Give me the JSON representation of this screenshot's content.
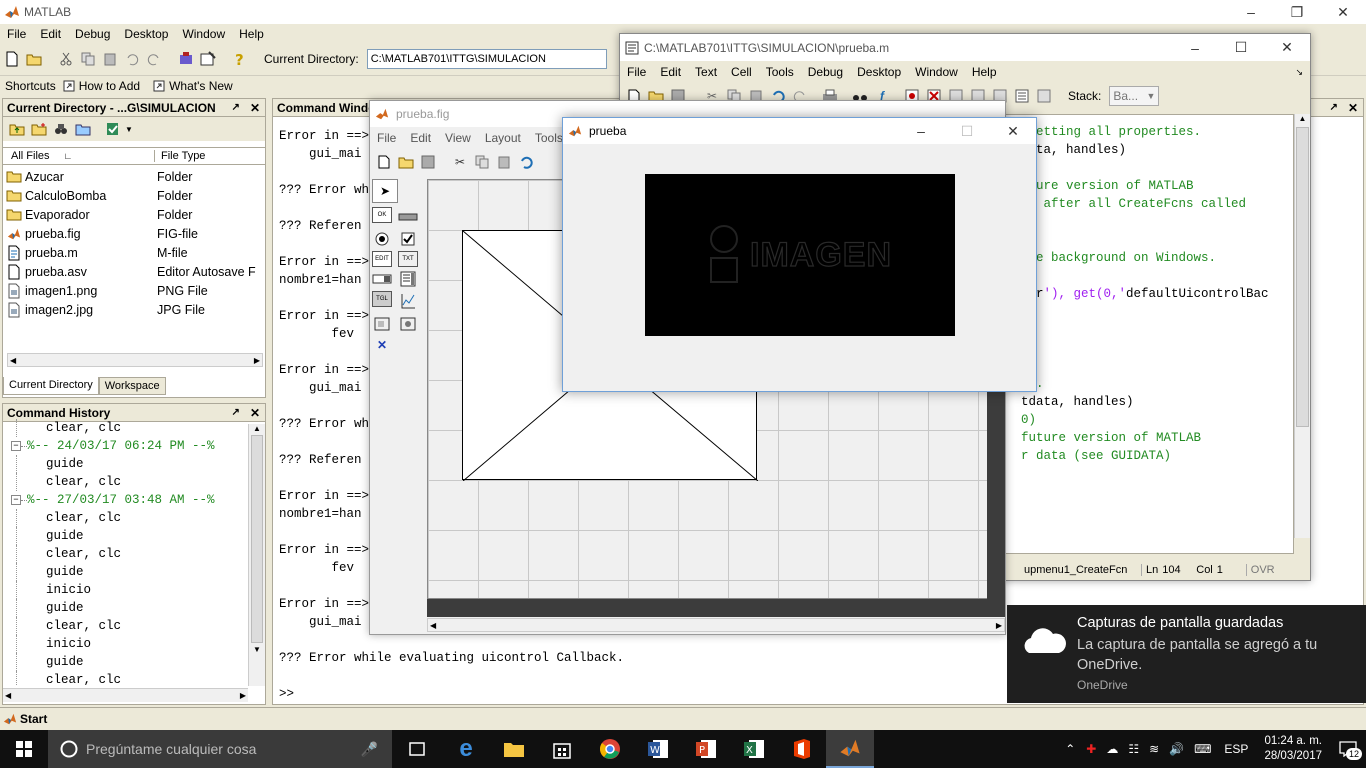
{
  "main_window": {
    "title": "MATLAB",
    "menu": [
      "File",
      "Edit",
      "Debug",
      "Desktop",
      "Window",
      "Help"
    ],
    "current_dir_label": "Current Directory:",
    "current_dir_value": "C:\\MATLAB701\\ITTG\\SIMULACION",
    "shortcuts": {
      "label": "Shortcuts",
      "how_to_add": "How to Add",
      "whats_new": "What's New"
    }
  },
  "current_directory": {
    "title": "Current Directory - ...G\\SIMULACION",
    "columns": [
      "All Files",
      "File Type"
    ],
    "files": [
      {
        "name": "Azucar",
        "type": "Folder",
        "icon": "folder-icon"
      },
      {
        "name": "CalculoBomba",
        "type": "Folder",
        "icon": "folder-icon"
      },
      {
        "name": "Evaporador",
        "type": "Folder",
        "icon": "folder-icon"
      },
      {
        "name": "prueba.fig",
        "type": "FIG-file",
        "icon": "matlab-fig-icon"
      },
      {
        "name": "prueba.m",
        "type": "M-file",
        "icon": "m-file-icon"
      },
      {
        "name": "prueba.asv",
        "type": "Editor Autosave F",
        "icon": "file-icon"
      },
      {
        "name": "imagen1.png",
        "type": "PNG File",
        "icon": "image-file-icon"
      },
      {
        "name": "imagen2.jpg",
        "type": "JPG File",
        "icon": "image-file-icon"
      }
    ],
    "tabs": [
      "Current Directory",
      "Workspace"
    ]
  },
  "command_history": {
    "title": "Command History",
    "items": [
      {
        "text": "clear, clc",
        "kind": "cmd"
      },
      {
        "text": "%-- 24/03/17 06:24 PM --%",
        "kind": "session"
      },
      {
        "text": "guide",
        "kind": "cmd"
      },
      {
        "text": "clear, clc",
        "kind": "cmd"
      },
      {
        "text": "%-- 27/03/17 03:48 AM --%",
        "kind": "session"
      },
      {
        "text": "clear, clc",
        "kind": "cmd"
      },
      {
        "text": "guide",
        "kind": "cmd"
      },
      {
        "text": "clear, clc",
        "kind": "cmd"
      },
      {
        "text": "guide",
        "kind": "cmd"
      },
      {
        "text": "inicio",
        "kind": "cmd"
      },
      {
        "text": "guide",
        "kind": "cmd"
      },
      {
        "text": "clear, clc",
        "kind": "cmd"
      },
      {
        "text": "inicio",
        "kind": "cmd"
      },
      {
        "text": "guide",
        "kind": "cmd"
      },
      {
        "text": "clear, clc",
        "kind": "cmd"
      }
    ]
  },
  "command_window": {
    "title": "Command Windo",
    "lines": [
      "Error in ==>",
      "    gui_mai",
      "",
      "??? Error wh",
      "",
      "??? Referen",
      "",
      "Error in ==>",
      "nombre1=han",
      "",
      "Error in ==>",
      "       fev",
      "",
      "Error in ==>",
      "    gui_mai",
      "",
      "??? Error wh",
      "",
      "??? Referen",
      "",
      "Error in ==>",
      "nombre1=han",
      "",
      "Error in ==>",
      "       fev",
      "",
      "Error in ==>",
      "    gui_mai",
      "",
      "??? Error while evaluating uicontrol Callback.",
      "",
      ">>"
    ]
  },
  "editor": {
    "title": "C:\\MATLAB701\\ITTG\\SIMULACION\\prueba.m",
    "menu": [
      "File",
      "Edit",
      "Text",
      "Cell",
      "Tools",
      "Debug",
      "Desktop",
      "Window",
      "Help"
    ],
    "stack_label": "Stack:",
    "stack_value": "Ba...",
    "lines": [
      {
        "text": " setting all properties.",
        "color": "#228b22"
      },
      {
        "text": "data, handles)",
        "color": "#000000"
      },
      {
        "text": "",
        "color": "#000000"
      },
      {
        "text": "uture version of MATLAB",
        "color": "#228b22"
      },
      {
        "text": "il after all CreateFcns called",
        "color": "#228b22"
      },
      {
        "text": "",
        "color": "#000000"
      },
      {
        "text": "",
        "color": "#000000"
      },
      {
        "text": "ite background on Windows.",
        "color": "#228b22"
      },
      {
        "text": "",
        "color": "#000000"
      },
      {
        "text": "lor'), get(0,'defaultUicontrolBac",
        "color": "mixed"
      },
      {
        "text": "",
        "color": "#000000"
      },
      {
        "text": "",
        "color": "#000000"
      },
      {
        "text": "",
        "color": "#000000"
      },
      {
        "text": "",
        "color": "#000000"
      },
      {
        "text": "n1.",
        "color": "#228b22"
      },
      {
        "text": "tdata, handles)",
        "color": "#000000"
      },
      {
        "text": "0)",
        "color": "#228b22"
      },
      {
        "text": "future version of MATLAB",
        "color": "#228b22"
      },
      {
        "text": "r data (see GUIDATA)",
        "color": "#228b22"
      }
    ],
    "status": {
      "function": "upmenu1_CreateFcn",
      "ln_label": "Ln",
      "ln": "104",
      "col_label": "Col",
      "col": "1",
      "mode": "OVR"
    }
  },
  "guide_window": {
    "title": "prueba.fig",
    "menu": [
      "File",
      "Edit",
      "View",
      "Layout",
      "Tools"
    ]
  },
  "figure_window": {
    "title": "prueba",
    "image_text": "IMAGEN"
  },
  "notification": {
    "title": "Capturas de pantalla guardadas",
    "body": "La captura de pantalla se agregó a tu OneDrive.",
    "source": "OneDrive"
  },
  "matlab_start": "Start",
  "taskbar": {
    "search_placeholder": "Pregúntame cualquier cosa",
    "language": "ESP",
    "time": "01:24 a. m.",
    "date": "28/03/2017",
    "notification_count": "12"
  },
  "colors": {
    "comment_green": "#228b22",
    "string_purple": "#a020f0",
    "taskbar": "#101010",
    "toast": "#1f1f1f"
  }
}
